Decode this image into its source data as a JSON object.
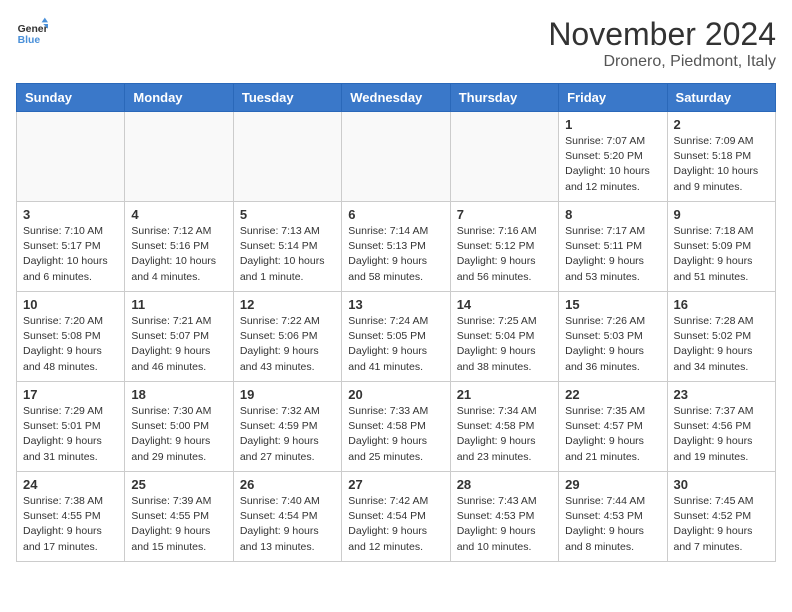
{
  "header": {
    "logo_line1": "General",
    "logo_line2": "Blue",
    "month": "November 2024",
    "location": "Dronero, Piedmont, Italy"
  },
  "weekdays": [
    "Sunday",
    "Monday",
    "Tuesday",
    "Wednesday",
    "Thursday",
    "Friday",
    "Saturday"
  ],
  "weeks": [
    [
      {
        "day": "",
        "info": ""
      },
      {
        "day": "",
        "info": ""
      },
      {
        "day": "",
        "info": ""
      },
      {
        "day": "",
        "info": ""
      },
      {
        "day": "",
        "info": ""
      },
      {
        "day": "1",
        "info": "Sunrise: 7:07 AM\nSunset: 5:20 PM\nDaylight: 10 hours and 12 minutes."
      },
      {
        "day": "2",
        "info": "Sunrise: 7:09 AM\nSunset: 5:18 PM\nDaylight: 10 hours and 9 minutes."
      }
    ],
    [
      {
        "day": "3",
        "info": "Sunrise: 7:10 AM\nSunset: 5:17 PM\nDaylight: 10 hours and 6 minutes."
      },
      {
        "day": "4",
        "info": "Sunrise: 7:12 AM\nSunset: 5:16 PM\nDaylight: 10 hours and 4 minutes."
      },
      {
        "day": "5",
        "info": "Sunrise: 7:13 AM\nSunset: 5:14 PM\nDaylight: 10 hours and 1 minute."
      },
      {
        "day": "6",
        "info": "Sunrise: 7:14 AM\nSunset: 5:13 PM\nDaylight: 9 hours and 58 minutes."
      },
      {
        "day": "7",
        "info": "Sunrise: 7:16 AM\nSunset: 5:12 PM\nDaylight: 9 hours and 56 minutes."
      },
      {
        "day": "8",
        "info": "Sunrise: 7:17 AM\nSunset: 5:11 PM\nDaylight: 9 hours and 53 minutes."
      },
      {
        "day": "9",
        "info": "Sunrise: 7:18 AM\nSunset: 5:09 PM\nDaylight: 9 hours and 51 minutes."
      }
    ],
    [
      {
        "day": "10",
        "info": "Sunrise: 7:20 AM\nSunset: 5:08 PM\nDaylight: 9 hours and 48 minutes."
      },
      {
        "day": "11",
        "info": "Sunrise: 7:21 AM\nSunset: 5:07 PM\nDaylight: 9 hours and 46 minutes."
      },
      {
        "day": "12",
        "info": "Sunrise: 7:22 AM\nSunset: 5:06 PM\nDaylight: 9 hours and 43 minutes."
      },
      {
        "day": "13",
        "info": "Sunrise: 7:24 AM\nSunset: 5:05 PM\nDaylight: 9 hours and 41 minutes."
      },
      {
        "day": "14",
        "info": "Sunrise: 7:25 AM\nSunset: 5:04 PM\nDaylight: 9 hours and 38 minutes."
      },
      {
        "day": "15",
        "info": "Sunrise: 7:26 AM\nSunset: 5:03 PM\nDaylight: 9 hours and 36 minutes."
      },
      {
        "day": "16",
        "info": "Sunrise: 7:28 AM\nSunset: 5:02 PM\nDaylight: 9 hours and 34 minutes."
      }
    ],
    [
      {
        "day": "17",
        "info": "Sunrise: 7:29 AM\nSunset: 5:01 PM\nDaylight: 9 hours and 31 minutes."
      },
      {
        "day": "18",
        "info": "Sunrise: 7:30 AM\nSunset: 5:00 PM\nDaylight: 9 hours and 29 minutes."
      },
      {
        "day": "19",
        "info": "Sunrise: 7:32 AM\nSunset: 4:59 PM\nDaylight: 9 hours and 27 minutes."
      },
      {
        "day": "20",
        "info": "Sunrise: 7:33 AM\nSunset: 4:58 PM\nDaylight: 9 hours and 25 minutes."
      },
      {
        "day": "21",
        "info": "Sunrise: 7:34 AM\nSunset: 4:58 PM\nDaylight: 9 hours and 23 minutes."
      },
      {
        "day": "22",
        "info": "Sunrise: 7:35 AM\nSunset: 4:57 PM\nDaylight: 9 hours and 21 minutes."
      },
      {
        "day": "23",
        "info": "Sunrise: 7:37 AM\nSunset: 4:56 PM\nDaylight: 9 hours and 19 minutes."
      }
    ],
    [
      {
        "day": "24",
        "info": "Sunrise: 7:38 AM\nSunset: 4:55 PM\nDaylight: 9 hours and 17 minutes."
      },
      {
        "day": "25",
        "info": "Sunrise: 7:39 AM\nSunset: 4:55 PM\nDaylight: 9 hours and 15 minutes."
      },
      {
        "day": "26",
        "info": "Sunrise: 7:40 AM\nSunset: 4:54 PM\nDaylight: 9 hours and 13 minutes."
      },
      {
        "day": "27",
        "info": "Sunrise: 7:42 AM\nSunset: 4:54 PM\nDaylight: 9 hours and 12 minutes."
      },
      {
        "day": "28",
        "info": "Sunrise: 7:43 AM\nSunset: 4:53 PM\nDaylight: 9 hours and 10 minutes."
      },
      {
        "day": "29",
        "info": "Sunrise: 7:44 AM\nSunset: 4:53 PM\nDaylight: 9 hours and 8 minutes."
      },
      {
        "day": "30",
        "info": "Sunrise: 7:45 AM\nSunset: 4:52 PM\nDaylight: 9 hours and 7 minutes."
      }
    ]
  ]
}
